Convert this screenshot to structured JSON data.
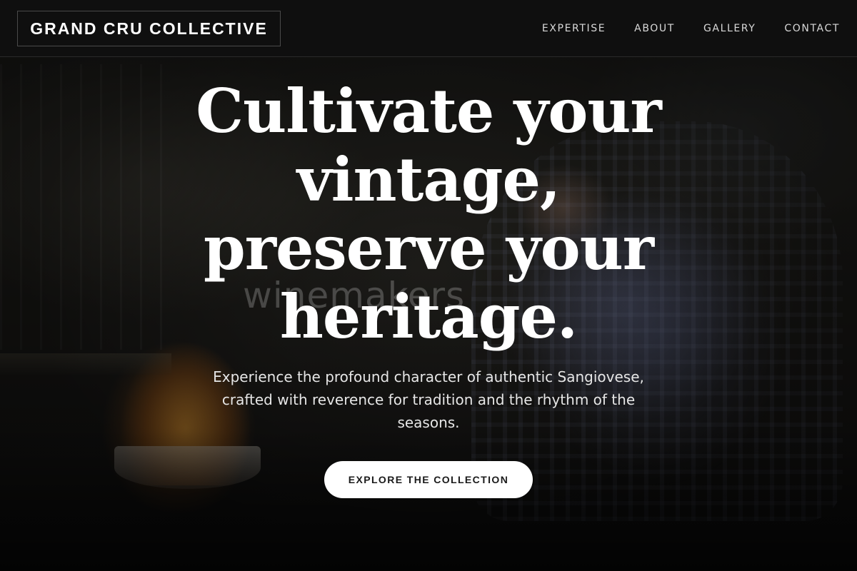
{
  "header": {
    "brand": "GRAND CRU COLLECTIVE",
    "nav": [
      {
        "label": "EXPERTISE"
      },
      {
        "label": "ABOUT"
      },
      {
        "label": "GALLERY"
      },
      {
        "label": "CONTACT"
      }
    ]
  },
  "hero": {
    "headline_lines": [
      "Cultivate your",
      "vintage,",
      "preserve your",
      "heritage."
    ],
    "watermark": "winemakers",
    "subtext": "Experience the profound character of authentic Sangiovese, crafted with reverence for tradition and the rhythm of the seasons.",
    "cta_label": "EXPLORE THE COLLECTION"
  },
  "colors": {
    "header_bg": "#101010",
    "button_bg": "#ffffff",
    "button_text": "#1a1a1a",
    "text": "#ffffff"
  }
}
